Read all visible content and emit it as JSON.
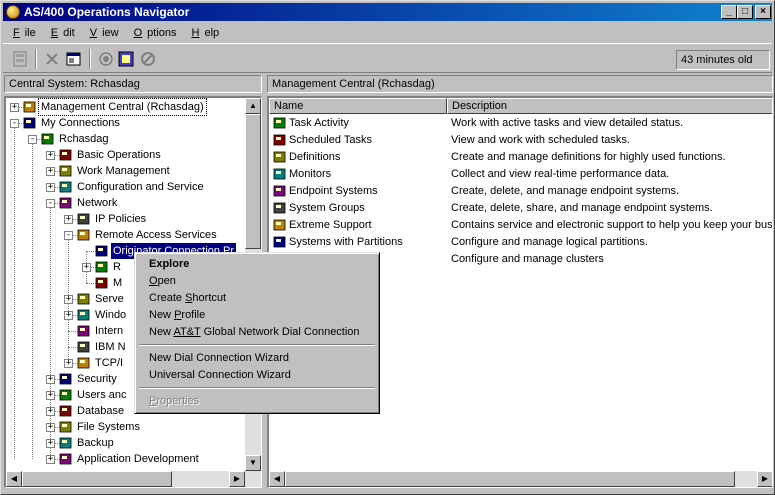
{
  "window": {
    "title": "AS/400 Operations Navigator",
    "minimize": "_",
    "maximize": "□",
    "close": "×"
  },
  "menu": [
    {
      "pre": "",
      "u": "F",
      "post": "ile"
    },
    {
      "pre": "",
      "u": "E",
      "post": "dit"
    },
    {
      "pre": "",
      "u": "V",
      "post": "iew"
    },
    {
      "pre": "",
      "u": "O",
      "post": "ptions"
    },
    {
      "pre": "",
      "u": "H",
      "post": "elp"
    }
  ],
  "toolbar": {
    "icons": [
      "hierarchy-icon",
      "delete-icon",
      "properties-icon",
      "connect-icon",
      "monitor-icon",
      "stop-icon"
    ],
    "age": "43 minutes old"
  },
  "left_header": "Central System: Rchasdag",
  "right_header": "Management Central (Rchasdag)",
  "tree": [
    {
      "label": "Management Central (Rchasdag)",
      "pm": "+",
      "level": 0,
      "icon": "management-central-icon"
    },
    {
      "label": "My Connections",
      "pm": "-",
      "level": 0,
      "icon": "connections-icon"
    },
    {
      "label": "Rchasdag",
      "pm": "-",
      "level": 1,
      "icon": "server-icon"
    },
    {
      "label": "Basic Operations",
      "pm": "+",
      "level": 2,
      "icon": "basic-operations-icon"
    },
    {
      "label": "Work Management",
      "pm": "+",
      "level": 2,
      "icon": "work-management-icon"
    },
    {
      "label": "Configuration and Service",
      "pm": "+",
      "level": 2,
      "icon": "configuration-icon"
    },
    {
      "label": "Network",
      "pm": "-",
      "level": 2,
      "icon": "network-icon"
    },
    {
      "label": "IP Policies",
      "pm": "+",
      "level": 3,
      "icon": "ip-policies-icon"
    },
    {
      "label": "Remote Access Services",
      "pm": "-",
      "level": 3,
      "icon": "remote-access-icon"
    },
    {
      "label": "Originator Connection Pr",
      "pm": "",
      "level": 4,
      "icon": "originator-icon"
    },
    {
      "label": "R",
      "pm": "+",
      "level": 4,
      "icon": "receiver-icon"
    },
    {
      "label": "M",
      "pm": "",
      "level": 4,
      "icon": "modem-icon"
    },
    {
      "label": "Serve",
      "pm": "+",
      "level": 3,
      "icon": "servers-icon"
    },
    {
      "label": "Windo",
      "pm": "+",
      "level": 3,
      "icon": "windows-icon"
    },
    {
      "label": "Intern",
      "pm": "",
      "level": 3,
      "icon": "internet-icon"
    },
    {
      "label": "IBM N",
      "pm": "",
      "level": 3,
      "icon": "ibm-network-icon"
    },
    {
      "label": "TCP/I",
      "pm": "+",
      "level": 3,
      "icon": "tcpip-icon"
    },
    {
      "label": "Security",
      "pm": "+",
      "level": 2,
      "icon": "security-icon"
    },
    {
      "label": "Users anc",
      "pm": "+",
      "level": 2,
      "icon": "users-icon"
    },
    {
      "label": "Database",
      "pm": "+",
      "level": 2,
      "icon": "database-icon"
    },
    {
      "label": "File Systems",
      "pm": "+",
      "level": 2,
      "icon": "file-systems-icon"
    },
    {
      "label": "Backup",
      "pm": "+",
      "level": 2,
      "icon": "backup-icon"
    },
    {
      "label": "Application Development",
      "pm": "+",
      "level": 2,
      "icon": "app-dev-icon"
    }
  ],
  "list": {
    "columns": [
      "Name",
      "Description"
    ],
    "rows": [
      {
        "name": "Task Activity",
        "desc": "Work with active tasks and view detailed status.",
        "icon": "task-activity-icon"
      },
      {
        "name": "Scheduled Tasks",
        "desc": "View and work with scheduled tasks.",
        "icon": "scheduled-tasks-icon"
      },
      {
        "name": "Definitions",
        "desc": "Create and manage definitions for highly used functions.",
        "icon": "definitions-icon"
      },
      {
        "name": "Monitors",
        "desc": "Collect and view real-time performance data.",
        "icon": "monitors-icon"
      },
      {
        "name": "Endpoint Systems",
        "desc": "Create, delete, and manage endpoint systems.",
        "icon": "endpoint-icon"
      },
      {
        "name": "System Groups",
        "desc": "Create, delete, share, and manage endpoint systems.",
        "icon": "system-groups-icon"
      },
      {
        "name": "Extreme Support",
        "desc": "Contains service and electronic support to help you keep your busi",
        "icon": "extreme-support-icon"
      },
      {
        "name": "Systems with Partitions",
        "desc": "Configure and manage logical partitions.",
        "icon": "partitions-icon"
      },
      {
        "name": "",
        "desc": "Configure and manage clusters",
        "icon": "clusters-icon"
      }
    ]
  },
  "context_menu": {
    "items": [
      {
        "pre": "",
        "u": "",
        "post": "Explore",
        "bold": true,
        "disabled": false
      },
      {
        "pre": "",
        "u": "O",
        "post": "pen",
        "bold": false,
        "disabled": false
      },
      {
        "pre": "Create ",
        "u": "S",
        "post": "hortcut",
        "bold": false,
        "disabled": false
      },
      {
        "pre": "New ",
        "u": "P",
        "post": "rofile",
        "bold": false,
        "disabled": false
      },
      {
        "pre": "New ",
        "u": "AT&T",
        "post": " Global Network Dial Connection",
        "bold": false,
        "disabled": false
      },
      {
        "sep": true
      },
      {
        "pre": "New Dial Connection Wizard",
        "u": "",
        "post": "",
        "bold": false,
        "disabled": false
      },
      {
        "pre": "Universal Connection Wizard",
        "u": "",
        "post": "",
        "bold": false,
        "disabled": false
      },
      {
        "sep": true
      },
      {
        "pre": "",
        "u": "P",
        "post": "roperties",
        "bold": false,
        "disabled": true
      }
    ]
  }
}
